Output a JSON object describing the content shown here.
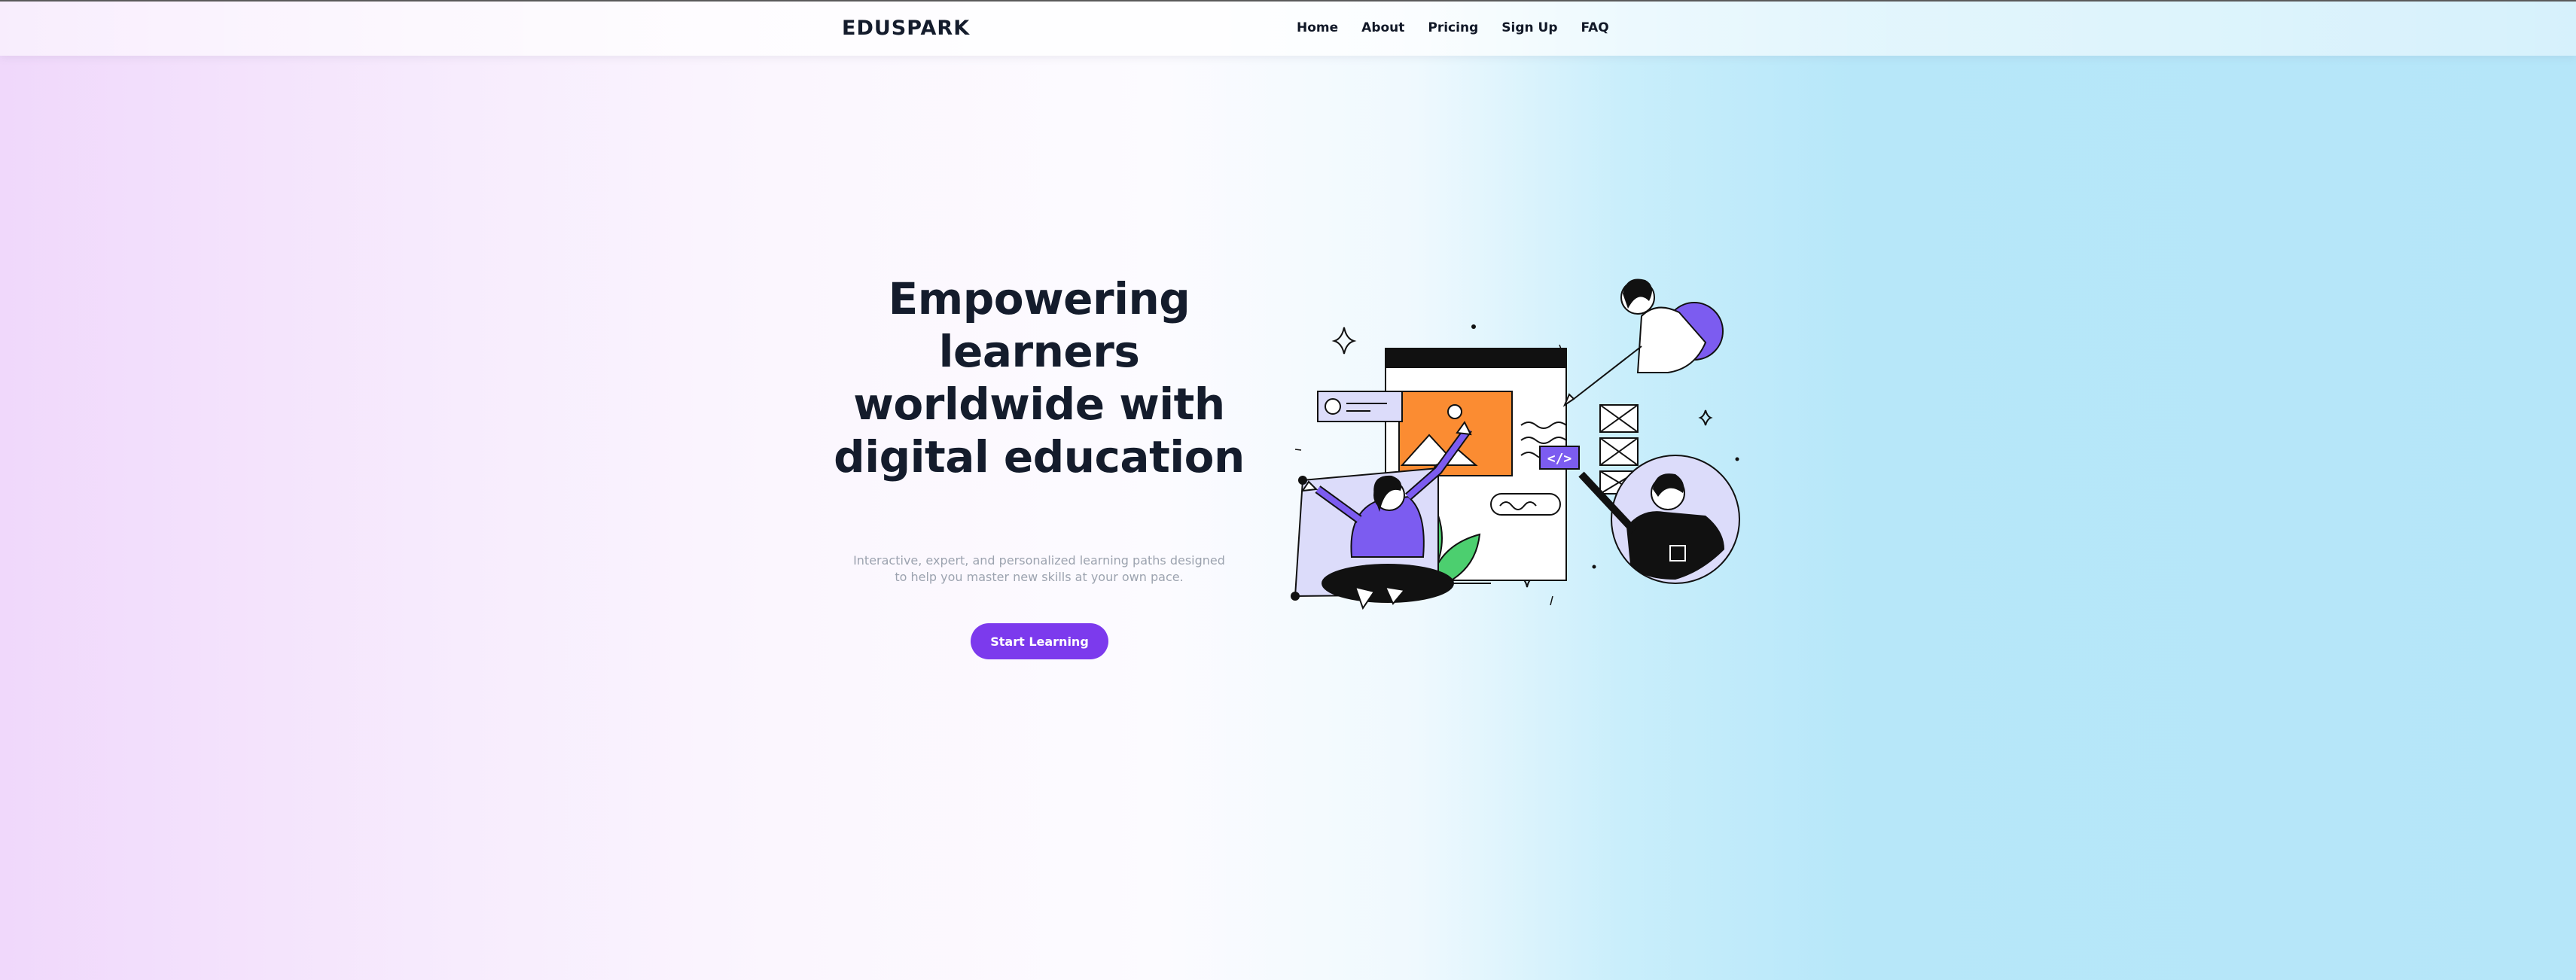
{
  "brand": {
    "name": "EDUSPARK"
  },
  "nav": {
    "items": [
      "Home",
      "About",
      "Pricing",
      "Sign Up",
      "FAQ"
    ]
  },
  "hero": {
    "title": "Empowering learners worldwide with digital education",
    "subtitle": "Interactive, expert, and personalized learning paths designed to help you master new skills at your own pace.",
    "cta_label": "Start Learning"
  },
  "illustration": {
    "description_icon": "online-learning-illustration",
    "code_tag": "</>"
  },
  "colors": {
    "accent": "#7c3aed",
    "text_dark": "#141c2c",
    "text_muted": "#9ca3af",
    "orange": "#fb8c32",
    "green": "#4ccf6f",
    "lavender": "#dcdcfa"
  }
}
